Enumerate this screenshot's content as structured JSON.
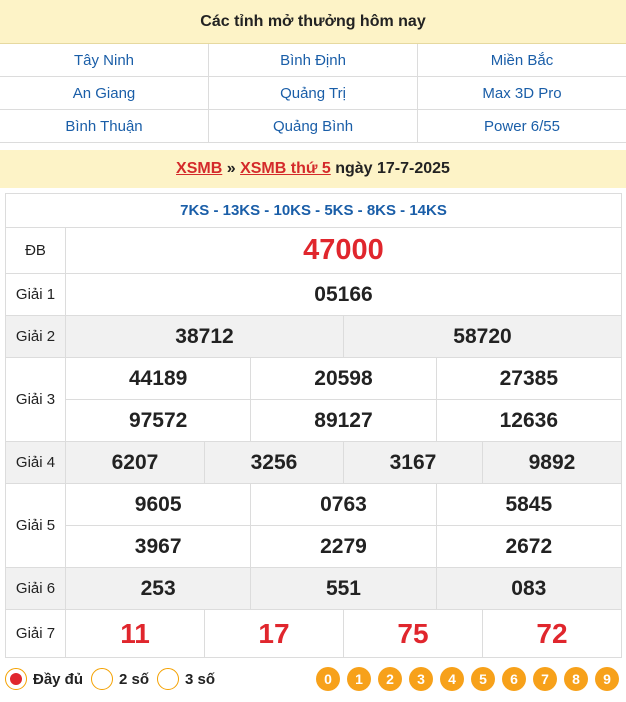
{
  "provinces_header": "Các tỉnh mở thưởng hôm nay",
  "provinces": [
    "Tây Ninh",
    "Bình Định",
    "Miền Bắc",
    "An Giang",
    "Quảng Trị",
    "Max 3D Pro",
    "Bình Thuận",
    "Quảng Bình",
    "Power 6/55"
  ],
  "result_header": {
    "link1": "XSMB",
    "sep": " » ",
    "link2": "XSMB thứ 5",
    "date": " ngày 17-7-2025"
  },
  "codes": "7KS - 13KS - 10KS - 5KS - 8KS - 14KS",
  "prizes": {
    "db": {
      "label": "ĐB",
      "values": [
        "47000"
      ]
    },
    "g1": {
      "label": "Giải 1",
      "values": [
        "05166"
      ]
    },
    "g2": {
      "label": "Giải 2",
      "values": [
        "38712",
        "58720"
      ]
    },
    "g3": {
      "label": "Giải 3",
      "values": [
        "44189",
        "20598",
        "27385",
        "97572",
        "89127",
        "12636"
      ]
    },
    "g4": {
      "label": "Giải 4",
      "values": [
        "6207",
        "3256",
        "3167",
        "9892"
      ]
    },
    "g5": {
      "label": "Giải 5",
      "values": [
        "9605",
        "0763",
        "5845",
        "3967",
        "2279",
        "2672"
      ]
    },
    "g6": {
      "label": "Giải 6",
      "values": [
        "253",
        "551",
        "083"
      ]
    },
    "g7": {
      "label": "Giải 7",
      "values": [
        "11",
        "17",
        "75",
        "72"
      ]
    }
  },
  "options": [
    {
      "label": "Đầy đủ",
      "selected": true
    },
    {
      "label": "2 số",
      "selected": false
    },
    {
      "label": "3 số",
      "selected": false
    }
  ],
  "digits": [
    "0",
    "1",
    "2",
    "3",
    "4",
    "5",
    "6",
    "7",
    "8",
    "9"
  ],
  "colors": {
    "accent_red": "#e0262d",
    "link_blue": "#1a5ea8",
    "header_bg": "#fdf3c7",
    "digit_orange": "#f7a11a"
  }
}
